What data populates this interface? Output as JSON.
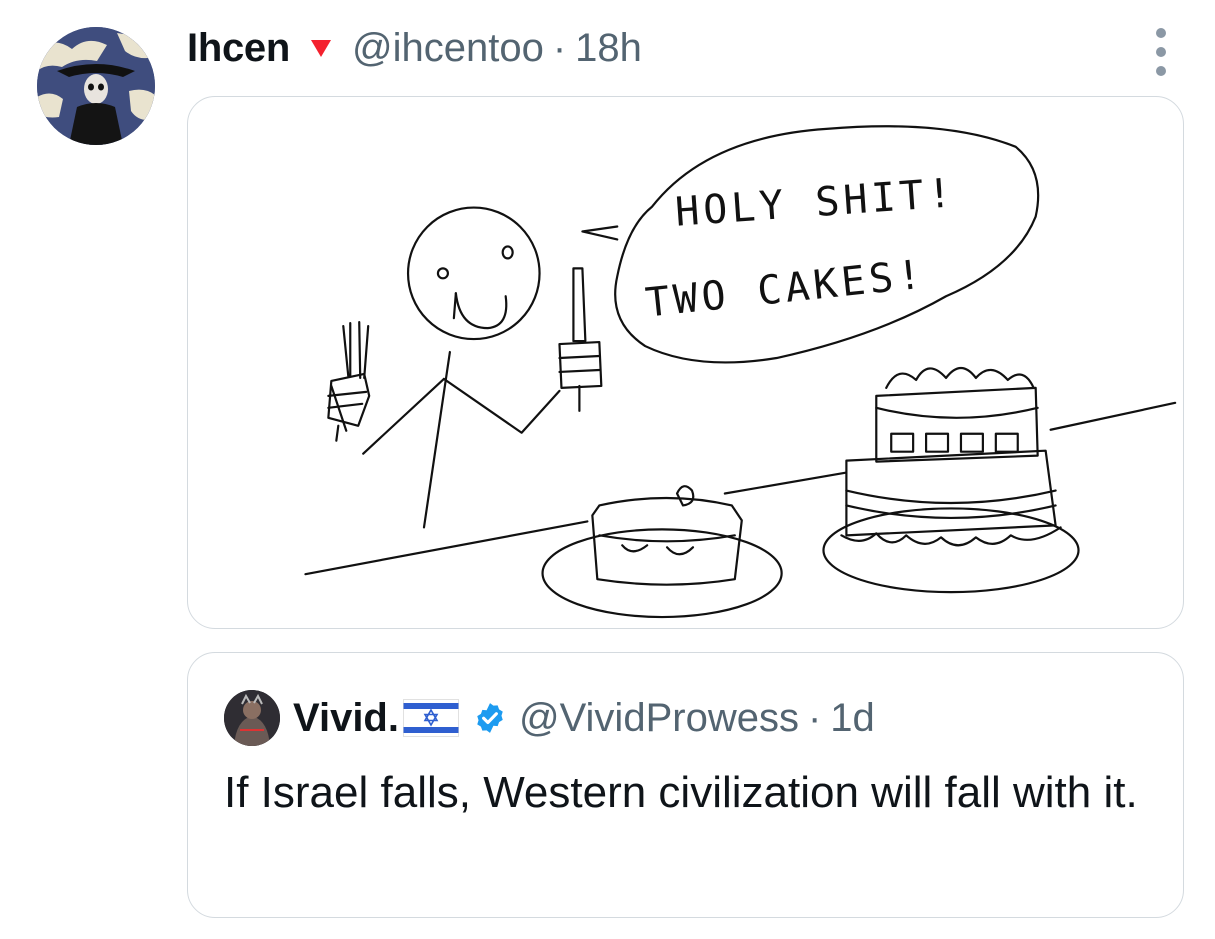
{
  "tweet": {
    "author": {
      "display_name": "Ihcen",
      "badge_icon": "red-triangle-icon",
      "handle": "@ihcentoo",
      "separator": "·",
      "time": "18h"
    },
    "more_icon": "more-vertical-icon",
    "media": {
      "kind": "hand-drawn doodle",
      "speech_line_1": "HOLY SHIT!",
      "speech_line_2": "TWO CAKES!"
    },
    "quote": {
      "display_name": "Vivid.",
      "flag_icon": "israel-flag-icon",
      "verified_icon": "verified-badge-icon",
      "handle": "@VividProwess",
      "separator": "·",
      "time": "1d",
      "text": "If Israel falls, Western civilization will fall with it."
    }
  },
  "colors": {
    "text": "#0f1419",
    "secondary": "#536471",
    "border": "#d4dadf",
    "verified": "#1d9bf0",
    "badge": "#f4212e"
  }
}
